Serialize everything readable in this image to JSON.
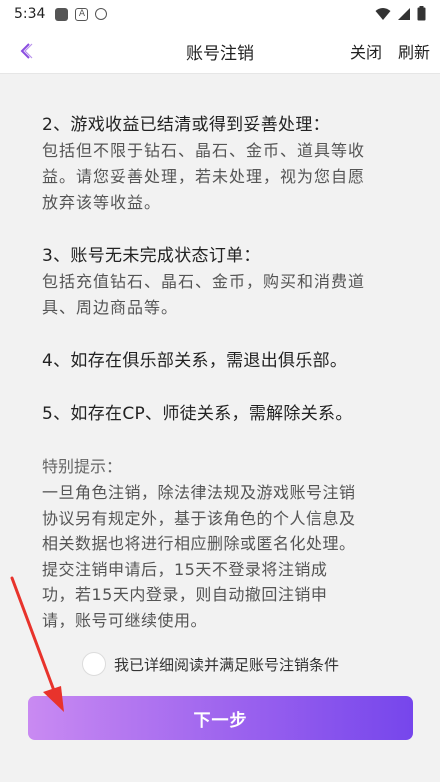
{
  "status_bar": {
    "time": "5:34",
    "icons": [
      "gallery-icon",
      "app-a-icon",
      "shield-icon",
      "wifi-icon",
      "signal-icon",
      "battery-icon"
    ]
  },
  "nav": {
    "title": "账号注销",
    "close_label": "关闭",
    "refresh_label": "刷新",
    "accent_color": "#8a4de0"
  },
  "sections": [
    {
      "title": "2、游戏收益已结清或得到妥善处理：",
      "lines": [
        "包括但不限于钻石、晶石、金币、道具等收",
        "益。请您妥善处理，若未处理，视为您自愿",
        "放弃该等收益。"
      ]
    },
    {
      "title": "3、账号无未完成状态订单：",
      "lines": [
        "包括充值钻石、晶石、金币，购买和消费道",
        "具、周边商品等。"
      ]
    },
    {
      "title": "4、如存在俱乐部关系，需退出俱乐部。",
      "lines": []
    },
    {
      "title": "5、如存在CP、师徒关系，需解除关系。",
      "lines": []
    }
  ],
  "notice": {
    "title": "特别提示：",
    "lines": [
      "一旦角色注销，除法律法规及游戏账号注销",
      "协议另有规定外，基于该角色的个人信息及",
      "相关数据也将进行相应删除或匿名化处理。",
      "提交注销申请后，15天不登录将注销成",
      "功，若15天内登录，则自动撤回注销申",
      "请，账号可继续使用。"
    ]
  },
  "agreement": {
    "label": "我已详细阅读并满足账号注销条件",
    "checked": false
  },
  "next_button": {
    "label": "下一步"
  }
}
